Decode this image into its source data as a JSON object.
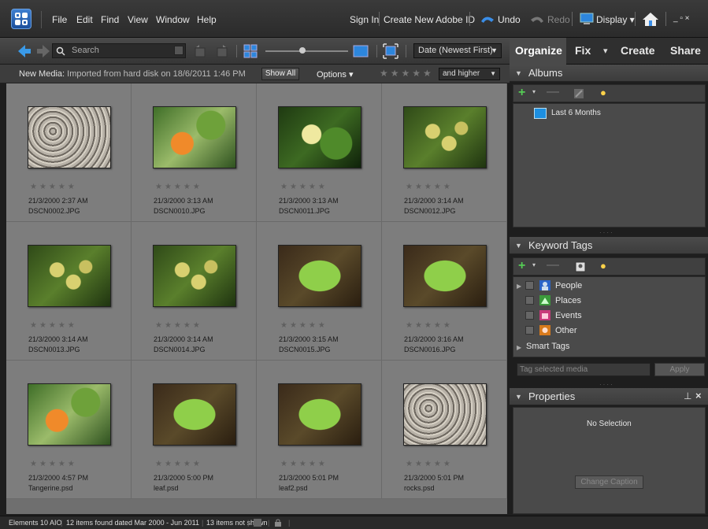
{
  "menu": {
    "items": [
      "File",
      "Edit",
      "Find",
      "View",
      "Window",
      "Help"
    ]
  },
  "topbar": {
    "sign_in": "Sign In",
    "create_id": "Create New Adobe ID",
    "undo": "Undo",
    "redo": "Redo",
    "display": "Display ▾",
    "window_controls": "_ ▫ ×"
  },
  "toolbar": {
    "search_placeholder": "Search",
    "sort": "Date (Newest First)"
  },
  "infobar": {
    "label": "New Media:",
    "text": "Imported from hard disk on 18/6/2011 1:46 PM",
    "show_all": "Show All",
    "options": "Options ▾",
    "rating_filter": "and higher"
  },
  "tabs": [
    "Organize",
    "Fix",
    "Create",
    "Share"
  ],
  "albums": {
    "title": "Albums",
    "items": [
      "Last 6 Months"
    ]
  },
  "keyword_tags": {
    "title": "Keyword Tags",
    "items": [
      "People",
      "Places",
      "Events",
      "Other"
    ],
    "smart_tags": "Smart Tags",
    "input_placeholder": "Tag selected media",
    "apply": "Apply"
  },
  "properties": {
    "title": "Properties",
    "no_selection": "No Selection",
    "change_caption": "Change Caption"
  },
  "media": [
    {
      "date": "21/3/2000 2:37 AM",
      "name": "DSCN0002.JPG",
      "kind": "rocks"
    },
    {
      "date": "21/3/2000 3:13 AM",
      "name": "DSCN0010.JPG",
      "kind": "orange"
    },
    {
      "date": "21/3/2000 3:13 AM",
      "name": "DSCN0011.JPG",
      "kind": "lemon"
    },
    {
      "date": "21/3/2000 3:14 AM",
      "name": "DSCN0012.JPG",
      "kind": "lemons"
    },
    {
      "date": "21/3/2000 3:14 AM",
      "name": "DSCN0013.JPG",
      "kind": "lemons"
    },
    {
      "date": "21/3/2000 3:14 AM",
      "name": "DSCN0014.JPG",
      "kind": "lemons"
    },
    {
      "date": "21/3/2000 3:15 AM",
      "name": "DSCN0015.JPG",
      "kind": "leaf"
    },
    {
      "date": "21/3/2000 3:16 AM",
      "name": "DSCN0016.JPG",
      "kind": "leaf"
    },
    {
      "date": "21/3/2000 4:57 PM",
      "name": "Tangerine.psd",
      "kind": "orange"
    },
    {
      "date": "21/3/2000 5:00 PM",
      "name": "leaf.psd",
      "kind": "leaf"
    },
    {
      "date": "21/3/2000 5:01 PM",
      "name": "leaf2.psd",
      "kind": "leaf"
    },
    {
      "date": "21/3/2000 5:01 PM",
      "name": "rocks.psd",
      "kind": "rocks"
    }
  ],
  "statusbar": {
    "app": "Elements 10 AIO",
    "summary": "12 items found dated Mar 2000 - Jun 2011",
    "hidden": "13 items not shown"
  }
}
